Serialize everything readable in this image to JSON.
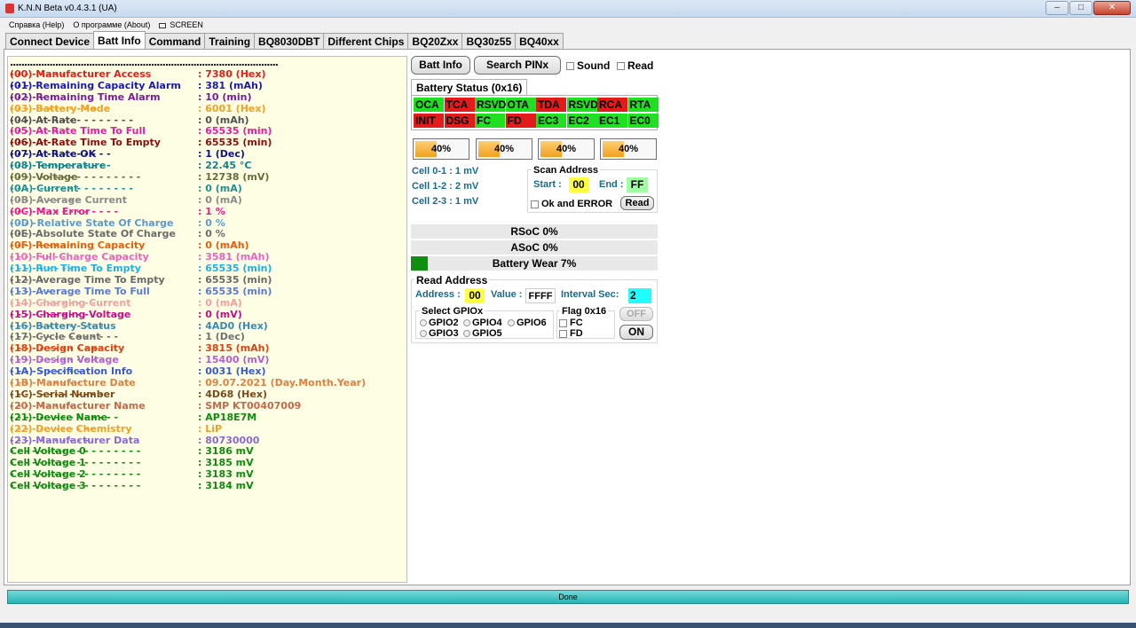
{
  "window": {
    "title": "K.N.N Beta v0.4.3.1 (UA)"
  },
  "menu": {
    "help": "Справка (Help)",
    "about": "О программе (About)",
    "screen": "SCREEN"
  },
  "tabs": [
    "Connect Device",
    "Batt Info",
    "Command",
    "Training",
    "BQ8030DBT",
    "Different Chips",
    "BQ20Zxx",
    "BQ30z55",
    "BQ40xx"
  ],
  "list": {
    "separator": "...............................................................................................",
    "rows": [
      {
        "label": "(00) Manufacturer Access",
        "dots": "- - - - - - - -",
        "value": ": 7380 (Hex)",
        "color": "#e0201a"
      },
      {
        "label": "(01) Remaining Capacity Alarm",
        "dots": "- - - -",
        "value": ": 381 (mAh)",
        "color": "#1a1ab0"
      },
      {
        "label": "(02) Remaining Time Alarm",
        "dots": "- - - - -",
        "value": ": 10 (min)",
        "color": "#7a1aa0"
      },
      {
        "label": "(03) Battery Mode",
        "dots": "- - - - - - - - - - - -",
        "value": ": 6001 (Hex)",
        "color": "#f0a020"
      },
      {
        "label": "(04) At Rate",
        "dots": "- - - - - - - - - - - - - - - - -",
        "value": ": 0 (mAh)",
        "color": "#505050"
      },
      {
        "label": "(05) At Rate Time To Full",
        "dots": "- - - - - - - -",
        "value": ": 65535 (min)",
        "color": "#e020a0"
      },
      {
        "label": "(06) At Rate Time To Empty",
        "dots": "- - - - - -",
        "value": ": 65535 (min)",
        "color": "#8a1010"
      },
      {
        "label": "(07) At Rate OK",
        "dots": "- - - - - - - - - - - - - -",
        "value": ": 1 (Dec)",
        "color": "#10108a"
      },
      {
        "label": "(08) Temperature",
        "dots": "- - - - - - - - - - - - - -",
        "value": ": 22.45 °C",
        "color": "#10808a"
      },
      {
        "label": "(09) Voltage",
        "dots": "- - - - - - - - - - - - - - - - - -",
        "value": ": 12738 (mV)",
        "color": "#6a6a3a"
      },
      {
        "label": "(0A) Current",
        "dots": "- - - - - - - - - - - - - - - - -",
        "value": ": 0 (mA)",
        "color": "#209090"
      },
      {
        "label": "(0B) Average Current",
        "dots": "- - - - - - - - - -",
        "value": ": 0 (mA)",
        "color": "#8a8a8a"
      },
      {
        "label": "(0C) Max Error",
        "dots": "- - - - - - - - - - - - - - -",
        "value": ": 1 %",
        "color": "#e0208a"
      },
      {
        "label": "(0D) Relative State Of Charge",
        "dots": "- - - -",
        "value": ": 0 %",
        "color": "#5a9ad0"
      },
      {
        "label": "(0E) Absolute State Of Charge",
        "dots": "- - - -",
        "value": ": 0 %",
        "color": "#6a6a6a"
      },
      {
        "label": "(0F) Remaining Capacity",
        "dots": "- - - - - - - - -",
        "value": ": 0 (mAh)",
        "color": "#e06010"
      },
      {
        "label": "(10) Full Charge Capacity",
        "dots": "- - - - - - - -",
        "value": ": 3581 (mAh)",
        "color": "#f060c0"
      },
      {
        "label": "(11) Run Time To Empty",
        "dots": "- - - - - - - - -",
        "value": ": 65535 (min)",
        "color": "#20b0e0"
      },
      {
        "label": "(12) Average Time To Empty",
        "dots": "- - - - -",
        "value": ": 65535 (min)",
        "color": "#6a6a6a"
      },
      {
        "label": "(13) Average Time To Full",
        "dots": "- - - - - -",
        "value": ": 65535 (min)",
        "color": "#5a7ad0"
      },
      {
        "label": "(14) Charging Current",
        "dots": "- - - - - - - - - - - -",
        "value": ": 0 (mA)",
        "color": "#f0a0a0"
      },
      {
        "label": "(15) Charging Voltage",
        "dots": "- - - - - - - - - - -",
        "value": ": 0 (mV)",
        "color": "#c0108a"
      },
      {
        "label": "(16) Battery Status",
        "dots": "- - - - - - - - - - - - -",
        "value": ": 4AD0 (Hex)",
        "color": "#3a8ab0"
      },
      {
        "label": "(17) Cycle Count",
        "dots": "- - - - - - - - - - - - - - -",
        "value": ": 1 (Dec)",
        "color": "#707070"
      },
      {
        "label": "(18) Design Capacity",
        "dots": "- - - - - - - - - - - -",
        "value": ": 3815 (mAh)",
        "color": "#e04010"
      },
      {
        "label": "(19) Design Voltage",
        "dots": "- - - - - - - - - - - - -",
        "value": ": 15400 (mV)",
        "color": "#b060d0"
      },
      {
        "label": "(1A) Specification Info",
        "dots": "- - - - - - - - - -",
        "value": ": 0031 (Hex)",
        "color": "#3a5ad0"
      },
      {
        "label": "(1B) Manufacture Date",
        "dots": "- - - - - - - - - -",
        "value": ": 09.07.2021 (Day.Month.Year)",
        "color": "#e08040"
      },
      {
        "label": "(1C) Serial Number",
        "dots": "- - - - - - - - - - - - -",
        "value": ": 4D68 (Hex)",
        "color": "#7a4a1a"
      },
      {
        "label": "(20) Manufacturer Name",
        "dots": "- - - - - - - - -",
        "value": ": SMP KT00407009",
        "color": "#c06a4a"
      },
      {
        "label": "(21) Device Name",
        "dots": "- - - - - - - - - - - - - - -",
        "value": ": AP18E7M",
        "color": "#108a10"
      },
      {
        "label": "(22) Device Chemistry",
        "dots": "- - - - - - - - - - - -",
        "value": ": LiP",
        "color": "#f0a020"
      },
      {
        "label": "(23) Manufacturer Data",
        "dots": "- - - - - - - - - - -",
        "value": ": 80730000",
        "color": "#8a6ad0"
      },
      {
        "label": "Cell Voltage 0",
        "dots": "- - - - - - - - - - - - - - - - - -",
        "value": ":  3186 mV",
        "color": "#108a10"
      },
      {
        "label": "Cell Voltage 1",
        "dots": "- - - - - - - - - - - - - - - - - -",
        "value": ":  3185 mV",
        "color": "#108a10"
      },
      {
        "label": "Cell Voltage 2",
        "dots": "- - - - - - - - - - - - - - - - - -",
        "value": ":  3183 mV",
        "color": "#108a10"
      },
      {
        "label": "Cell Voltage 3",
        "dots": "- - - - - - - - - - - - - - - - - -",
        "value": ":  3184 mV",
        "color": "#108a10"
      }
    ]
  },
  "controls": {
    "batt_info": "Batt Info",
    "search_pinx": "Search PINx",
    "sound": "Sound",
    "read": "Read"
  },
  "battery_status": {
    "title": "Battery Status (0x16)",
    "row1": [
      {
        "label": "OCA",
        "state": "g"
      },
      {
        "label": "TCA",
        "state": "r"
      },
      {
        "label": "RSVD",
        "state": "g"
      },
      {
        "label": "OTA",
        "state": "g"
      },
      {
        "label": "TDA",
        "state": "r"
      },
      {
        "label": "RSVD",
        "state": "g"
      },
      {
        "label": "RCA",
        "state": "r"
      },
      {
        "label": "RTA",
        "state": "g"
      }
    ],
    "row2": [
      {
        "label": "INIT",
        "state": "r"
      },
      {
        "label": "DSG",
        "state": "r"
      },
      {
        "label": "FC",
        "state": "g"
      },
      {
        "label": "FD",
        "state": "r"
      },
      {
        "label": "EC3",
        "state": "g"
      },
      {
        "label": "EC2",
        "state": "g"
      },
      {
        "label": "EC1",
        "state": "g"
      },
      {
        "label": "EC0",
        "state": "g"
      }
    ]
  },
  "cells_progress": [
    {
      "text": "40%",
      "value": 0.4
    },
    {
      "text": "40%",
      "value": 0.4
    },
    {
      "text": "40%",
      "value": 0.4
    },
    {
      "text": "40%",
      "value": 0.4
    }
  ],
  "cell_diff": [
    "Cell 0-1 : 1 mV",
    "Cell 1-2 : 2 mV",
    "Cell 2-3 : 1 mV"
  ],
  "scan": {
    "title": "Scan Address",
    "start_label": "Start :",
    "start": "00",
    "end_label": "End :",
    "end": "FF",
    "ok_error": "Ok and ERROR",
    "read_btn": "Read"
  },
  "soc": {
    "rsoc": "RSoC 0%",
    "asoc": "ASoC 0%",
    "wear": "Battery Wear 7%",
    "wear_value": 0.07
  },
  "read_address": {
    "title": "Read Address",
    "address_label": "Address :",
    "address": "00",
    "value_label": "Value :",
    "value": "FFFF",
    "interval_label": "Interval Sec:",
    "interval": "2",
    "gpio_title": "Select GPIOx",
    "gpio": [
      "GPIO2",
      "GPIO4",
      "GPIO6",
      "GPIO3",
      "GPIO5"
    ],
    "flag_title": "Flag 0x16",
    "fc": "FC",
    "fd": "FD",
    "off": "OFF",
    "on": "ON"
  },
  "status": {
    "text": "Done"
  }
}
